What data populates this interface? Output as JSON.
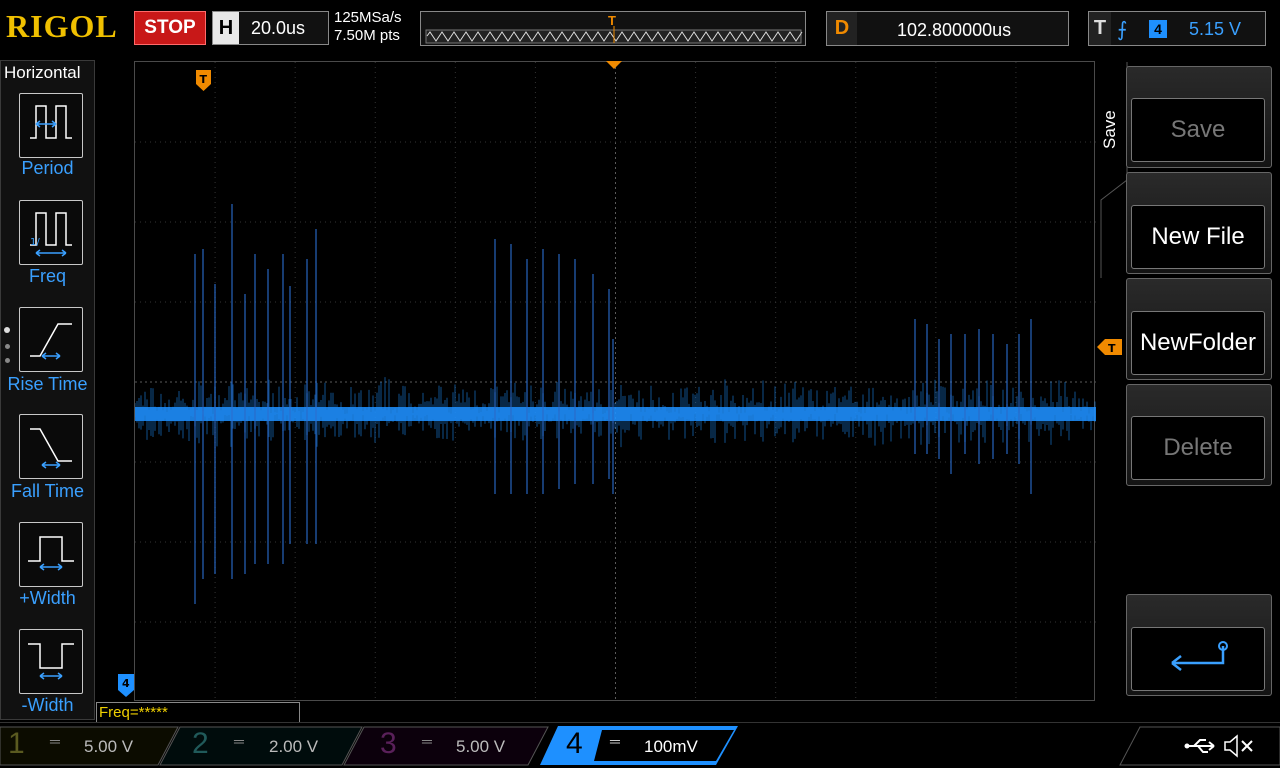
{
  "header": {
    "logo": "RIGOL",
    "run_status": "STOP",
    "timebase_key": "H",
    "timebase_value": "20.0us",
    "sample_rate": "125MSa/s",
    "memory_depth": "7.50M pts",
    "delay_key": "D",
    "delay_value": "102.800000us",
    "trigger_key": "T",
    "trigger_edge_icon": "rising-edge-icon",
    "trigger_source": "4",
    "trigger_level": "5.15 V",
    "trigger_marker": "T"
  },
  "left_menu": {
    "title": "Horizontal",
    "items": [
      {
        "label": "Period",
        "icon": "period-icon"
      },
      {
        "label": "Freq",
        "icon": "freq-icon"
      },
      {
        "label": "Rise Time",
        "icon": "rise-time-icon"
      },
      {
        "label": "Fall Time",
        "icon": "fall-time-icon"
      },
      {
        "label": "+Width",
        "icon": "pos-width-icon"
      },
      {
        "label": "-Width",
        "icon": "neg-width-icon"
      }
    ]
  },
  "right_menu": {
    "title": "Save",
    "items": [
      {
        "label": "Save",
        "enabled": false
      },
      {
        "label": "New File",
        "enabled": true
      },
      {
        "label": "NewFolder",
        "enabled": true
      },
      {
        "label": "Delete",
        "enabled": false
      },
      {
        "label": "",
        "icon": "enter-return-icon",
        "enabled": true
      }
    ]
  },
  "status": {
    "freq_readout": "Freq=*****"
  },
  "channels": [
    {
      "number": "1",
      "scale": "5.00 V",
      "coupling": "DC",
      "active": false,
      "color": "#d8c000"
    },
    {
      "number": "2",
      "scale": "2.00 V",
      "coupling": "DC",
      "active": false,
      "color": "#00c8c8"
    },
    {
      "number": "3",
      "scale": "5.00 V",
      "coupling": "DC",
      "active": false,
      "color": "#d040d0"
    },
    {
      "number": "4",
      "scale": "100mV",
      "coupling": "DC",
      "active": true,
      "color": "#1e90ff"
    }
  ],
  "colors": {
    "trace": "#1e90ff",
    "trigger_marker": "#f08a00",
    "stop": "#c81818",
    "logo": "#f0c000"
  },
  "icons": {
    "usb": "usb-icon",
    "mute": "speaker-mute-icon"
  }
}
